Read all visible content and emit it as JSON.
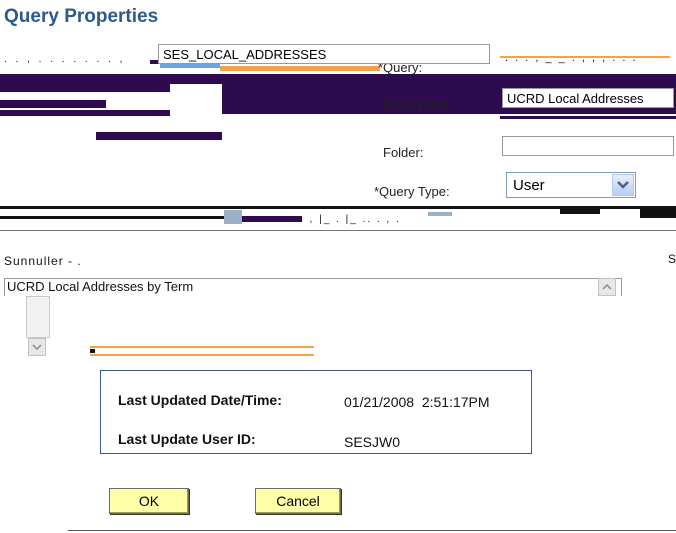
{
  "page": {
    "title": "Query Properties"
  },
  "query_field": {
    "label": "*Query:",
    "value": "SES_LOCAL_ADDRESSES"
  },
  "description_field": {
    "label": "Description:",
    "value": "UCRD Local Addresses"
  },
  "folder_field": {
    "label": "Folder:",
    "value": ""
  },
  "query_type_field": {
    "label": "*Query Type:",
    "selected": "User"
  },
  "long_description": {
    "value": "UCRD Local Addresses by Term"
  },
  "info": {
    "last_updated_label": "Last Updated Date/Time:",
    "last_updated_value": "01/21/2008  2:51:17PM",
    "last_user_label": "Last Update User ID:",
    "last_user_value": "SESJW0"
  },
  "buttons": {
    "ok_label": "OK",
    "cancel_label": "Cancel"
  },
  "colors": {
    "title": "#2d5a8e",
    "glitch_purple": "#2e0a4f",
    "glitch_orange": "#f4a24a",
    "glitch_blue": "#6ea7dd",
    "button_face": "#ffffa8"
  }
}
